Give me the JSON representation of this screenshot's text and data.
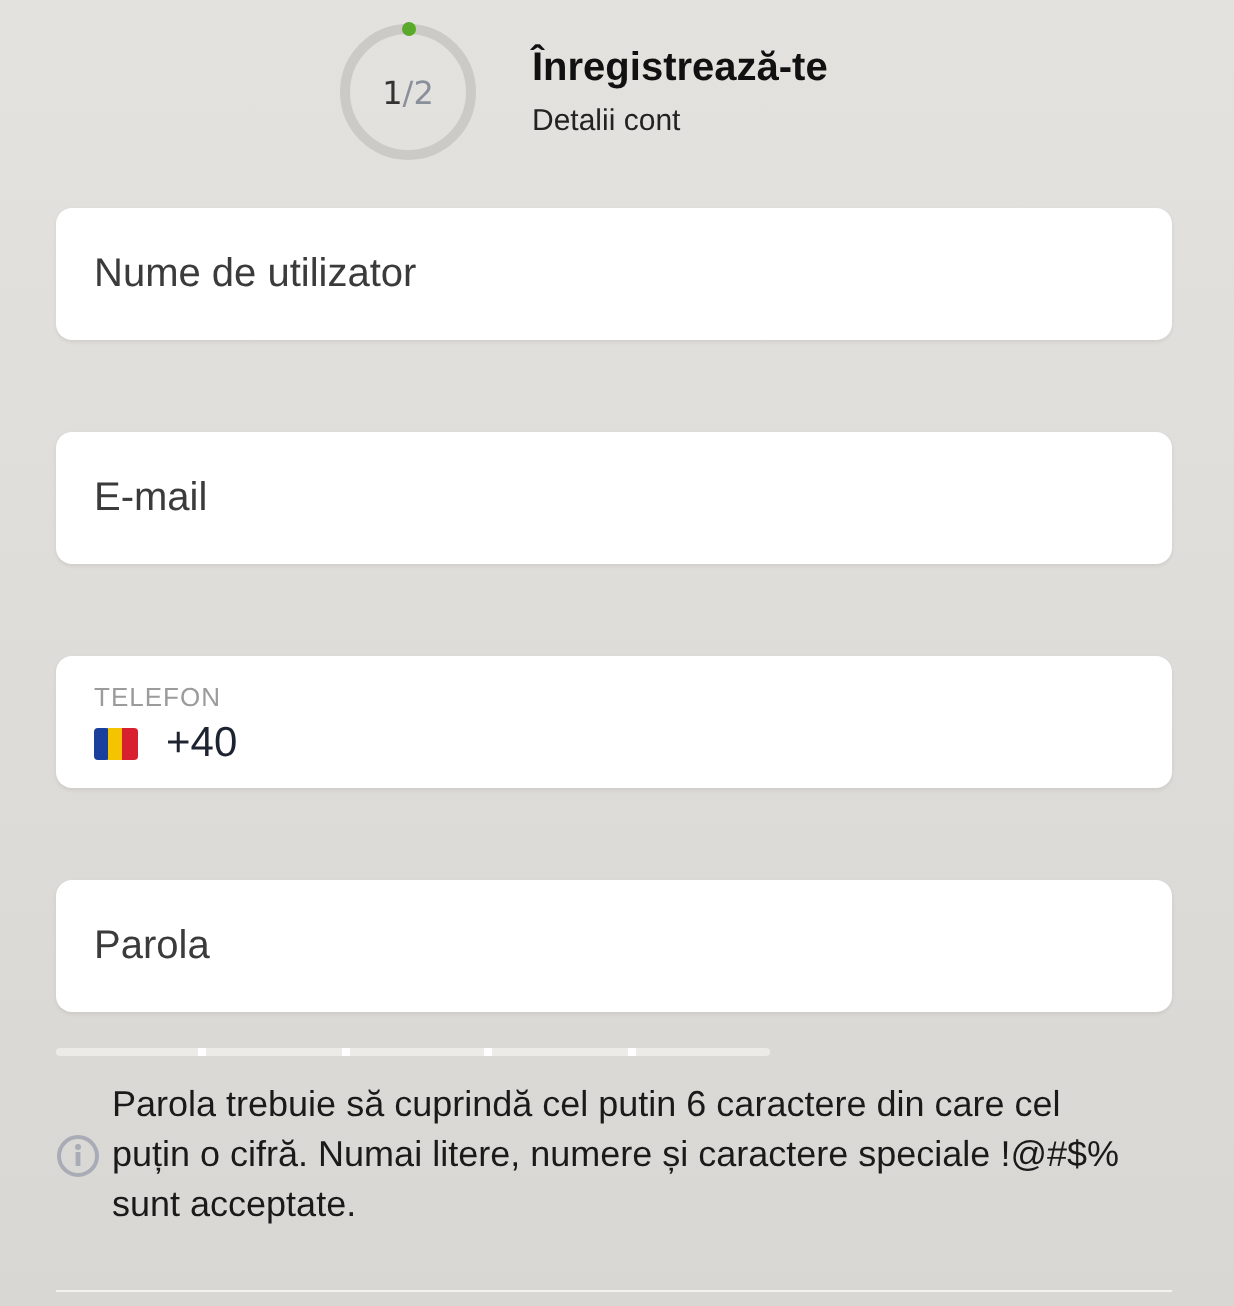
{
  "header": {
    "step_current": "1",
    "step_separator": "/",
    "step_total": "2",
    "title": "Înregistrează-te",
    "subtitle": "Detalii cont"
  },
  "fields": [
    {
      "kind": "text",
      "placeholder": "Nume de utilizator"
    },
    {
      "kind": "text",
      "placeholder": "E-mail"
    },
    {
      "kind": "phone",
      "label": "TELEFON",
      "value": "+40"
    },
    {
      "kind": "text",
      "placeholder": "Parola"
    }
  ],
  "password_hint": "Parola trebuie să cuprindă cel putin 6 caractere din care cel puțin o cifră. Numai litere, numere și caractere speciale !@#$% sunt acceptate."
}
